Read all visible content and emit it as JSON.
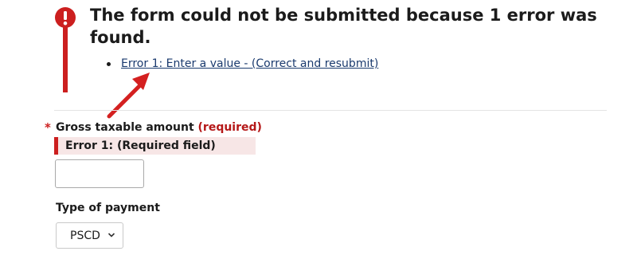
{
  "error_summary": {
    "title": "The form could not be submitted because 1 error was found.",
    "errors": [
      {
        "link_text": "Error 1: Enter a value - (Correct and resubmit)"
      }
    ],
    "icon": "exclamation-circle-icon",
    "accent_color": "#cc1f1f"
  },
  "gross_taxable_amount": {
    "required_marker": "*",
    "label": "Gross taxable amount",
    "required_text": "(required)",
    "error_message": "Error 1: (Required field)",
    "value": ""
  },
  "type_of_payment": {
    "label": "Type of payment",
    "selected_value": "PSCD"
  },
  "annotation": {
    "icon": "red-arrow-icon"
  }
}
